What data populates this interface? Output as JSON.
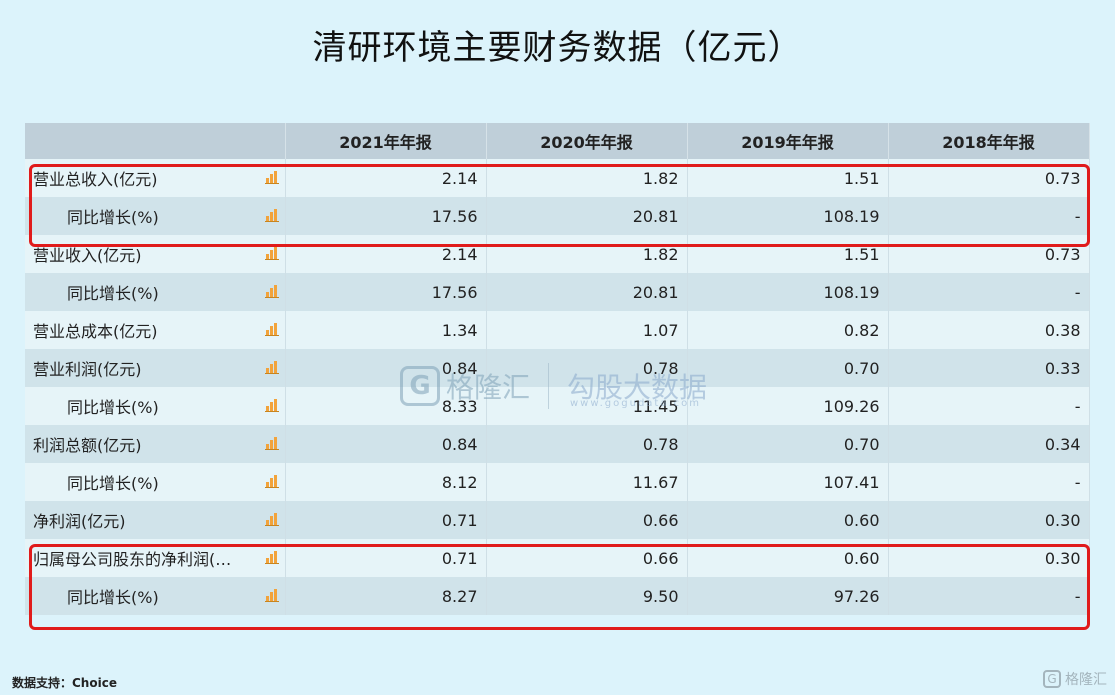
{
  "title": "清研环境主要财务数据（亿元）",
  "table": {
    "header": [
      "",
      "2021年年报",
      "2020年年报",
      "2019年年报",
      "2018年年报"
    ],
    "rows": [
      {
        "label": "营业总收入(亿元)",
        "indent": false,
        "values": [
          "2.14",
          "1.82",
          "1.51",
          "0.73"
        ]
      },
      {
        "label": "同比增长(%)",
        "indent": true,
        "values": [
          "17.56",
          "20.81",
          "108.19",
          "-"
        ]
      },
      {
        "label": "营业收入(亿元)",
        "indent": false,
        "values": [
          "2.14",
          "1.82",
          "1.51",
          "0.73"
        ]
      },
      {
        "label": "同比增长(%)",
        "indent": true,
        "values": [
          "17.56",
          "20.81",
          "108.19",
          "-"
        ]
      },
      {
        "label": "营业总成本(亿元)",
        "indent": false,
        "values": [
          "1.34",
          "1.07",
          "0.82",
          "0.38"
        ]
      },
      {
        "label": "营业利润(亿元)",
        "indent": false,
        "values": [
          "0.84",
          "0.78",
          "0.70",
          "0.33"
        ]
      },
      {
        "label": "同比增长(%)",
        "indent": true,
        "values": [
          "8.33",
          "11.45",
          "109.26",
          "-"
        ]
      },
      {
        "label": "利润总额(亿元)",
        "indent": false,
        "values": [
          "0.84",
          "0.78",
          "0.70",
          "0.34"
        ]
      },
      {
        "label": "同比增长(%)",
        "indent": true,
        "values": [
          "8.12",
          "11.67",
          "107.41",
          "-"
        ]
      },
      {
        "label": "净利润(亿元)",
        "indent": false,
        "values": [
          "0.71",
          "0.66",
          "0.60",
          "0.30"
        ]
      },
      {
        "label": "归属母公司股东的净利润(…",
        "indent": false,
        "values": [
          "0.71",
          "0.66",
          "0.60",
          "0.30"
        ]
      },
      {
        "label": "同比增长(%)",
        "indent": true,
        "values": [
          "8.27",
          "9.50",
          "97.26",
          "-"
        ]
      }
    ]
  },
  "watermark": {
    "logo_letter": "G",
    "brand": "格隆汇",
    "brand2": "勾股大数据",
    "url": "www.gogudata.com"
  },
  "source": "数据支持：Choice",
  "corner_logo": {
    "letter": "G",
    "text": "格隆汇"
  },
  "colors": {
    "highlight": "#e01b1b",
    "icon": "#f2a33b",
    "background": "#dcf3fb"
  }
}
